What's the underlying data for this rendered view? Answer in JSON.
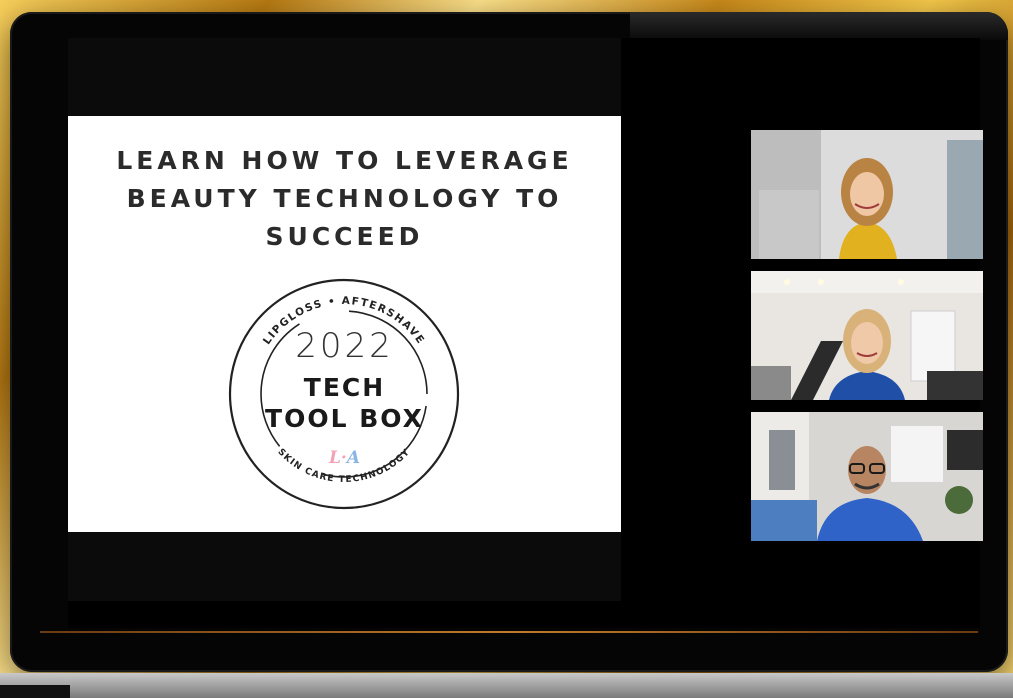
{
  "slide": {
    "headline": "LEARN HOW TO LEVERAGE BEAUTY TECHNOLOGY TO SUCCEED",
    "badge": {
      "top_arc_text": "LIPGLOSS • AFTERSHAVE",
      "year": "2022",
      "title_line1": "TECH",
      "title_line2": "TOOL BOX",
      "logo_left": "L",
      "logo_sep": "·",
      "logo_right": "A",
      "bottom_arc_text": "SKIN CARE TECHNOLOGY"
    }
  },
  "participants": [
    {
      "tile": "participant-1",
      "shirt_color": "#e0b020"
    },
    {
      "tile": "participant-2",
      "shirt_color": "#1f4fa6"
    },
    {
      "tile": "participant-3",
      "shirt_color": "#2f63c8"
    }
  ]
}
